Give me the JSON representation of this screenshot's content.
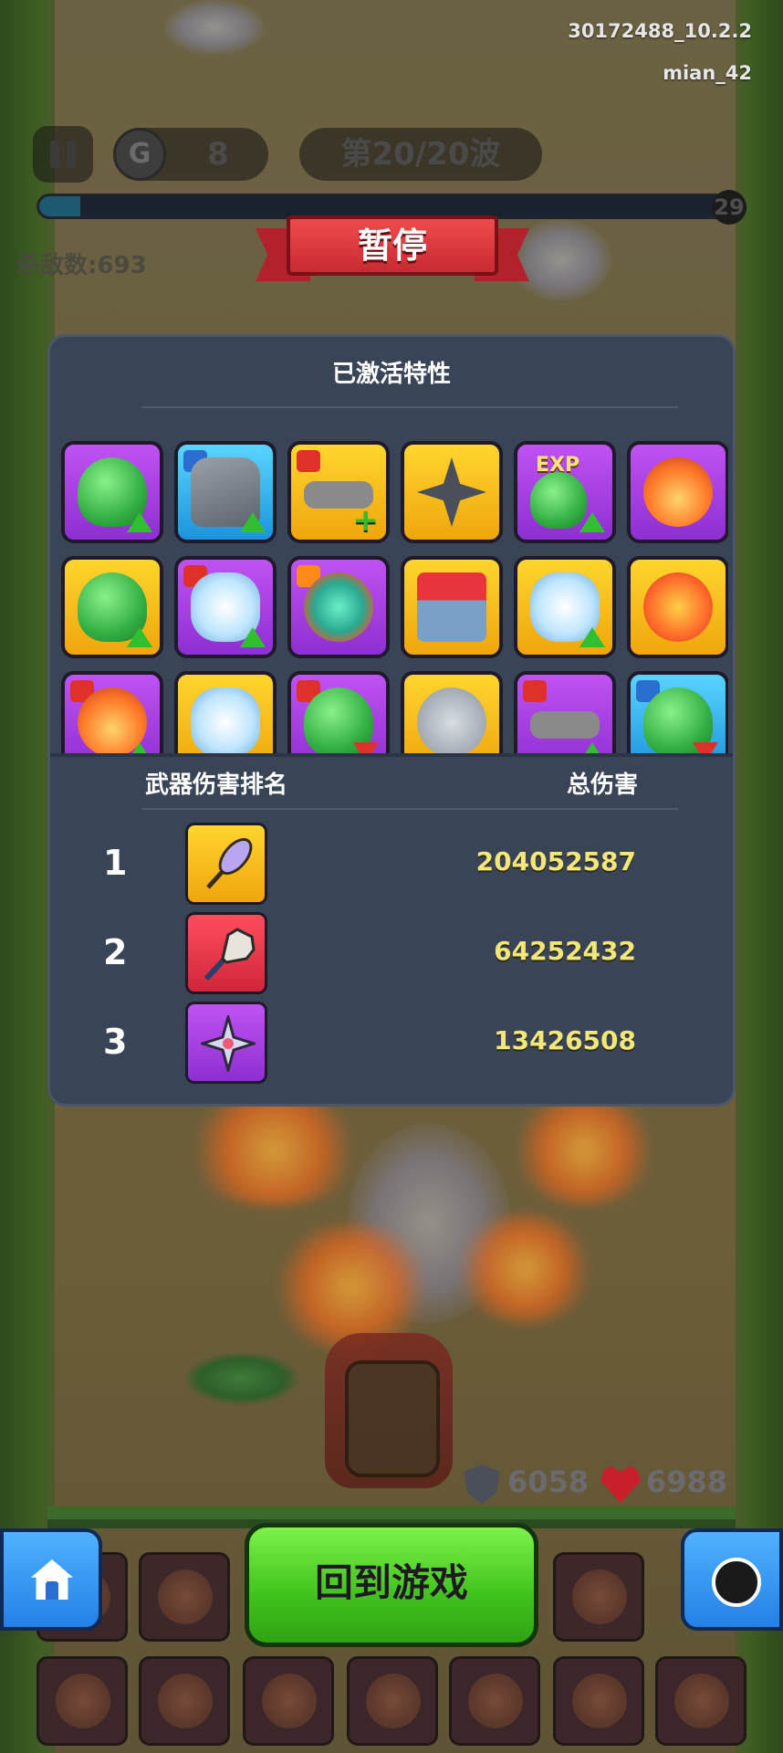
{
  "hud": {
    "build_id": "30172488_10.2.2",
    "player_name": "mian_42",
    "coins": "8",
    "wave": "第20/20波",
    "level": "29",
    "xp_fraction": 0.06,
    "kills": "杀敌数:693"
  },
  "pause_banner": "暂停",
  "traits": {
    "heading": "已激活特性",
    "icons": [
      "slime-coins-up-icon",
      "glove-up-icon",
      "belt-plus-icon",
      "shuriken-icon",
      "exp-slime-up-icon",
      "fireball-icon",
      "slime-coins-up-icon",
      "tornado-up-icon",
      "fire-slime-icon",
      "shop-icon",
      "triple-tornado-up-icon",
      "explosion-expand-icon",
      "fireball-up-icon",
      "tornado-wings-icon",
      "slime-down-icon",
      "coin-stack-icon",
      "belt-up-icon",
      "slime-down-icon"
    ]
  },
  "ranking": {
    "heading_left": "武器伤害排名",
    "heading_right": "总伤害",
    "rows": [
      {
        "rank": "1",
        "damage": "204052587",
        "weapon_icon": "feather-staff-icon",
        "color": "yellow"
      },
      {
        "rank": "2",
        "damage": "64252432",
        "weapon_icon": "feather-duster-icon",
        "color": "red"
      },
      {
        "rank": "3",
        "damage": "13426508",
        "weapon_icon": "shuriken-icon",
        "color": "purple"
      }
    ]
  },
  "status": {
    "shield": "6058",
    "health": "6988"
  },
  "buttons": {
    "resume": "回到游戏",
    "home_icon": "home-icon",
    "settings_icon": "gear-icon"
  },
  "colors": {
    "panel": "#3a4457",
    "damage_text": "#f3e77a",
    "resume_green": "#3fc21c",
    "banner_red": "#c82a32"
  }
}
